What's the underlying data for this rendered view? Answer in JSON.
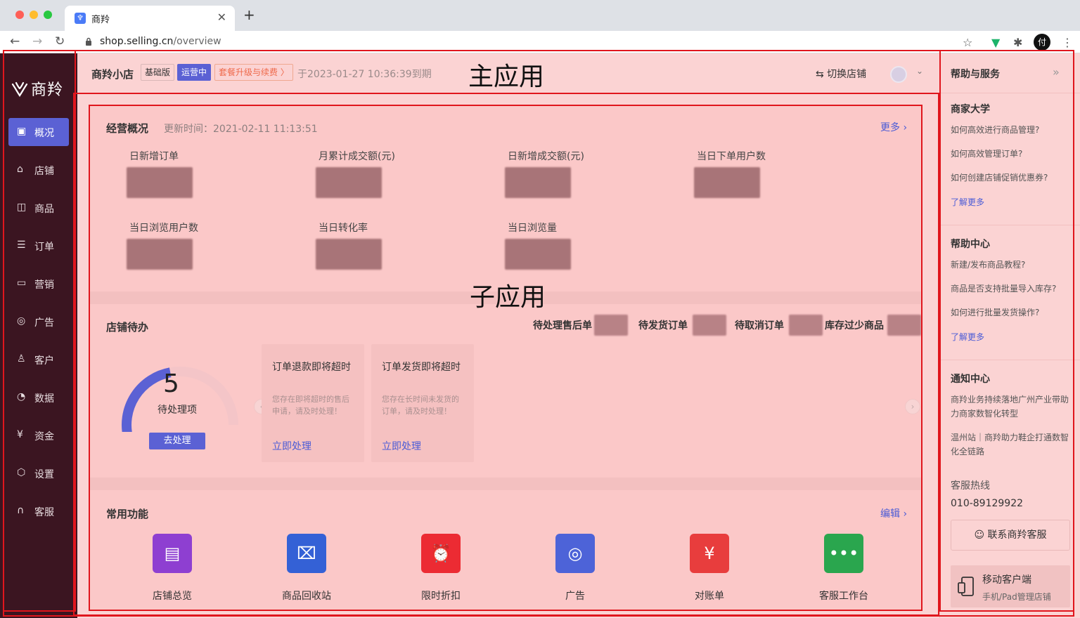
{
  "browser": {
    "tab_title": "商羚",
    "tab_close": "✕",
    "new_tab": "+",
    "url_host": "shop.selling.cn",
    "url_path": "/overview"
  },
  "sidebar": {
    "logo_text": "商羚",
    "items": [
      {
        "label": "概况",
        "icon": "chart-icon"
      },
      {
        "label": "店铺",
        "icon": "store-icon"
      },
      {
        "label": "商品",
        "icon": "bag-icon"
      },
      {
        "label": "订单",
        "icon": "clipboard-icon"
      },
      {
        "label": "营销",
        "icon": "ticket-icon"
      },
      {
        "label": "广告",
        "icon": "target-icon"
      },
      {
        "label": "客户",
        "icon": "user-icon"
      },
      {
        "label": "数据",
        "icon": "pie-icon"
      },
      {
        "label": "资金",
        "icon": "yen-icon"
      },
      {
        "label": "设置",
        "icon": "gear-icon"
      },
      {
        "label": "客服",
        "icon": "headset-icon"
      }
    ]
  },
  "header": {
    "shop_name": "商羚小店",
    "badge_basic": "基础版",
    "badge_status": "运营中",
    "badge_upgrade": "套餐升级与续费 〉",
    "expire_text": "于2023-01-27 10:36:39到期",
    "switch_store": "⇆  切换店铺",
    "main_app_label": "主应用"
  },
  "overview": {
    "title": "经营概况",
    "update_time": "更新时间：2021-02-11 11:13:51",
    "more": "更多 ›",
    "metrics": [
      "日新增订单",
      "月累计成交额(元)",
      "日新增成交额(元)",
      "当日下单用户数",
      "当日浏览用户数",
      "当日转化率",
      "当日浏览量"
    ]
  },
  "sub_app_label": "子应用",
  "todo": {
    "title": "店铺待办",
    "stats": [
      "待处理售后单",
      "待发货订单",
      "待取消订单",
      "库存过少商品"
    ],
    "pending_count": "5",
    "pending_label": "待处理项",
    "pending_progress": 0.3,
    "go_button": "去处理",
    "cards": [
      {
        "title": "订单退款即将超时",
        "desc": "您存在即将超时的售后申请，请及时处理！",
        "link": "立即处理"
      },
      {
        "title": "订单发货即将超时",
        "desc": "您存在长时间未发货的订单，请及时处理！",
        "link": "立即处理"
      }
    ]
  },
  "functions": {
    "title": "常用功能",
    "edit": "编辑 ›",
    "items": [
      {
        "label": "店铺总览",
        "color": "#8e3fd1",
        "icon": "shop-icon"
      },
      {
        "label": "商品回收站",
        "color": "#3461d6",
        "icon": "recycle-bag-icon"
      },
      {
        "label": "限时折扣",
        "color": "#ec2b33",
        "icon": "alarm-clock-icon"
      },
      {
        "label": "广告",
        "color": "#4d63d8",
        "icon": "target-icon"
      },
      {
        "label": "对账单",
        "color": "#e83d3d",
        "icon": "statement-icon"
      },
      {
        "label": "客服工作台",
        "color": "#2aa64e",
        "icon": "chat-icon"
      }
    ]
  },
  "help": {
    "title": "帮助与服务",
    "collapse": "»",
    "university_title": "商家大学",
    "university_links": [
      "如何高效进行商品管理?",
      "如何高效管理订单?",
      "如何创建店铺促销优惠券?"
    ],
    "university_more": "了解更多",
    "center_title": "帮助中心",
    "center_links": [
      "新建/发布商品教程?",
      "商品是否支持批量导入库存?",
      "如何进行批量发货操作?"
    ],
    "center_more": "了解更多",
    "notice_title": "通知中心",
    "notices": [
      "商羚业务持续落地广州产业带助力商家数智化转型",
      "温州站｜商羚助力鞋企打通数智化全链路"
    ],
    "hotline_label": "客服热线",
    "hotline": "010-89129922",
    "service_button": "联系商羚客服",
    "mobile_title": "移动客户端",
    "mobile_sub": "手机/Pad管理店铺"
  },
  "colors": {
    "sidebar_bg": "#3b1521",
    "accent": "#5b61d4",
    "overlay": "#fbd3d3",
    "outline": "#e0161d"
  }
}
